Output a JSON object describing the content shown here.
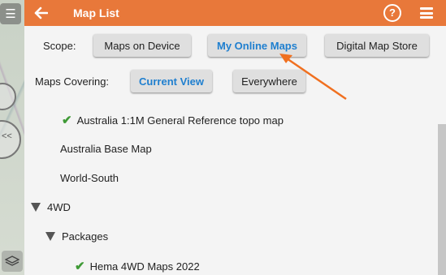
{
  "header": {
    "title": "Map List",
    "help_glyph": "?",
    "back_icon": "back-arrow-icon",
    "menu_icon": "hamburger-menu-icon"
  },
  "scope": {
    "label": "Scope:",
    "buttons": [
      "Maps on Device",
      "My Online Maps",
      "Digital Map Store"
    ],
    "selected": "My Online Maps"
  },
  "covering": {
    "label": "Maps Covering:",
    "buttons": [
      "Current View",
      "Everywhere"
    ],
    "selected": "Current View"
  },
  "list": [
    {
      "label": "Australia 1:1M General Reference topo map",
      "checked": true
    },
    {
      "label": "Australia Base Map",
      "checked": false
    },
    {
      "label": "World-South",
      "checked": false
    },
    {
      "label": "4WD",
      "expanded": true
    },
    {
      "label": "Packages",
      "expanded": true
    },
    {
      "label": "Hema 4WD Maps 2022",
      "checked": true
    }
  ],
  "colors": {
    "header": "#e8783a",
    "accent_blue": "#1f7fcf",
    "check_green": "#3f9a36",
    "annotation_arrow": "#f07020"
  },
  "left_strip": {
    "text": "<<"
  }
}
